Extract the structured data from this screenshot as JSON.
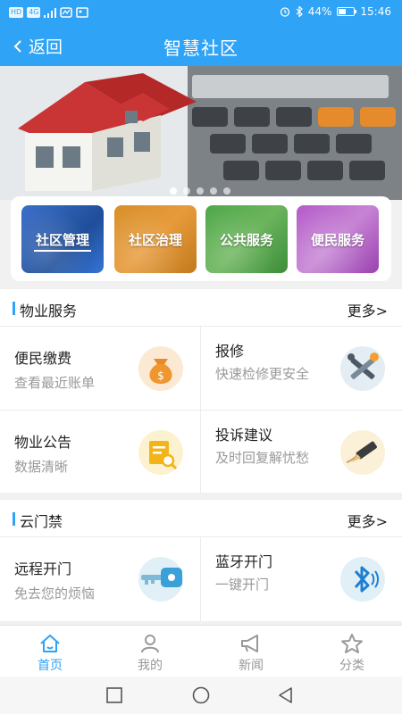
{
  "status_bar": {
    "left_chips": [
      "HD",
      "4G"
    ],
    "battery": "44%",
    "time": "15:46"
  },
  "header": {
    "back_label": "返回",
    "title": "智慧社区"
  },
  "quick_links": [
    {
      "label": "社区管理"
    },
    {
      "label": "社区治理"
    },
    {
      "label": "公共服务"
    },
    {
      "label": "便民服务"
    }
  ],
  "property_section": {
    "title": "物业服务",
    "more": "更多>",
    "items": [
      {
        "title": "便民缴费",
        "subtitle": "查看最近账单",
        "icon": "money-bag-icon"
      },
      {
        "title": "报修",
        "subtitle": "快速检修更安全",
        "icon": "tools-icon"
      },
      {
        "title": "物业公告",
        "subtitle": "数据清晰",
        "icon": "notice-search-icon"
      },
      {
        "title": "投诉建议",
        "subtitle": "及时回复解忧愁",
        "icon": "pen-icon"
      }
    ]
  },
  "door_section": {
    "title": "云门禁",
    "more": "更多>",
    "items": [
      {
        "title": "远程开门",
        "subtitle": "免去您的烦恼",
        "icon": "key-icon"
      },
      {
        "title": "蓝牙开门",
        "subtitle": "一键开门",
        "icon": "bluetooth-icon"
      }
    ]
  },
  "tabbar": {
    "active_color": "#2fa3f5",
    "tabs": [
      {
        "label": "首页",
        "icon": "home-icon"
      },
      {
        "label": "我的",
        "icon": "user-icon"
      },
      {
        "label": "新闻",
        "icon": "megaphone-icon"
      },
      {
        "label": "分类",
        "icon": "star-icon"
      }
    ]
  }
}
